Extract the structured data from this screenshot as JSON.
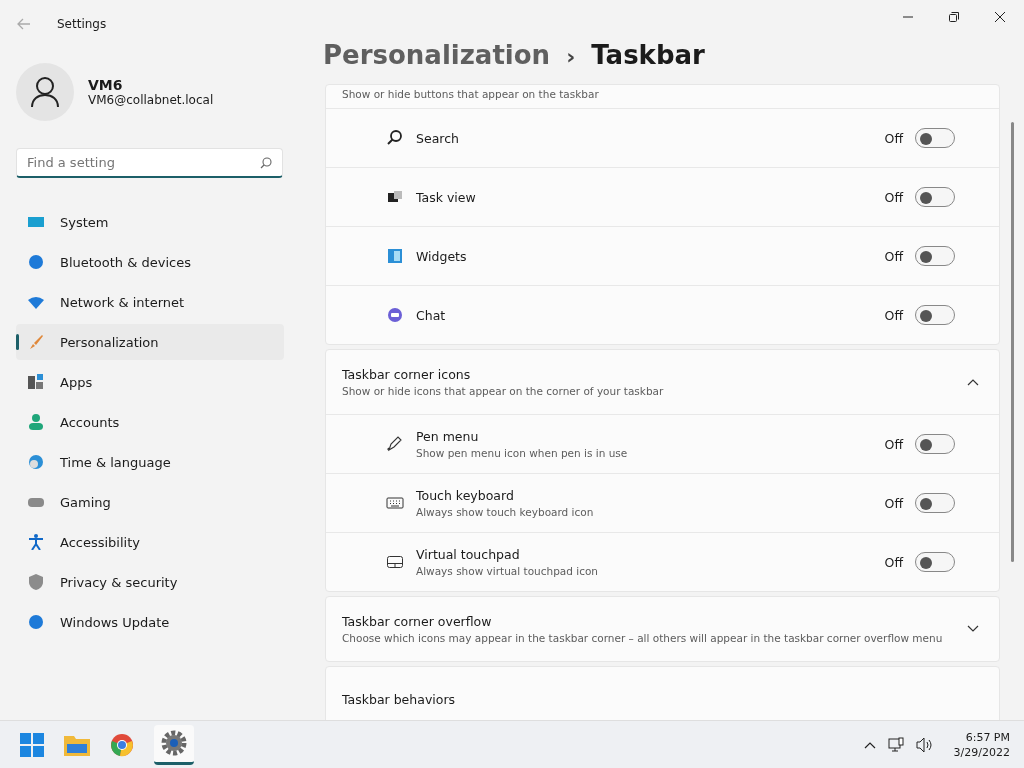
{
  "window": {
    "title": "Settings"
  },
  "user": {
    "name": "VM6",
    "email": "VM6@collabnet.local"
  },
  "search": {
    "placeholder": "Find a setting"
  },
  "sidebar": {
    "items": [
      {
        "label": "System",
        "selected": false
      },
      {
        "label": "Bluetooth & devices",
        "selected": false
      },
      {
        "label": "Network & internet",
        "selected": false
      },
      {
        "label": "Personalization",
        "selected": true
      },
      {
        "label": "Apps",
        "selected": false
      },
      {
        "label": "Accounts",
        "selected": false
      },
      {
        "label": "Time & language",
        "selected": false
      },
      {
        "label": "Gaming",
        "selected": false
      },
      {
        "label": "Accessibility",
        "selected": false
      },
      {
        "label": "Privacy & security",
        "selected": false
      },
      {
        "label": "Windows Update",
        "selected": false
      }
    ]
  },
  "breadcrumb": {
    "parent": "Personalization",
    "separator": "›",
    "current": "Taskbar"
  },
  "sections": [
    {
      "description": "Show or hide buttons that appear on the taskbar",
      "rows": [
        {
          "label": "Search",
          "state_label": "Off",
          "on": false
        },
        {
          "label": "Task view",
          "state_label": "Off",
          "on": false
        },
        {
          "label": "Widgets",
          "state_label": "Off",
          "on": false
        },
        {
          "label": "Chat",
          "state_label": "Off",
          "on": false
        }
      ]
    },
    {
      "title": "Taskbar corner icons",
      "description": "Show or hide icons that appear on the corner of your taskbar",
      "expanded": true,
      "rows": [
        {
          "label": "Pen menu",
          "description": "Show pen menu icon when pen is in use",
          "state_label": "Off",
          "on": false
        },
        {
          "label": "Touch keyboard",
          "description": "Always show touch keyboard icon",
          "state_label": "Off",
          "on": false
        },
        {
          "label": "Virtual touchpad",
          "description": "Always show virtual touchpad icon",
          "state_label": "Off",
          "on": false
        }
      ]
    },
    {
      "title": "Taskbar corner overflow",
      "description": "Choose which icons may appear in the taskbar corner – all others will appear in the taskbar corner overflow menu",
      "expanded": false
    },
    {
      "title": "Taskbar behaviors"
    }
  ],
  "taskbar": {
    "time": "6:57 PM",
    "date": "3/29/2022"
  }
}
